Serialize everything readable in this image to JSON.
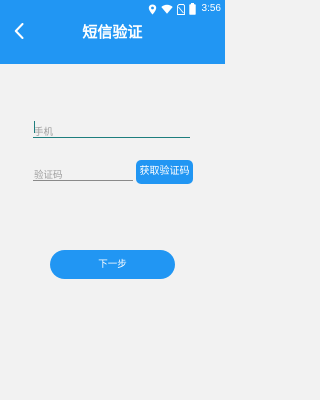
{
  "status_bar": {
    "time": "3:56",
    "icons": [
      "location-icon",
      "wifi-icon",
      "no-sim-icon",
      "battery-icon"
    ]
  },
  "header": {
    "title": "短信验证",
    "back_icon": "chevron-left-icon"
  },
  "form": {
    "phone_placeholder": "手机",
    "phone_value": "",
    "code_placeholder": "验证码",
    "code_value": "",
    "get_code_label": "获取验证码",
    "next_label": "下一步"
  },
  "colors": {
    "primary": "#2196F3",
    "background": "#F2F2F2",
    "focus_underline": "#1E7E7E"
  }
}
